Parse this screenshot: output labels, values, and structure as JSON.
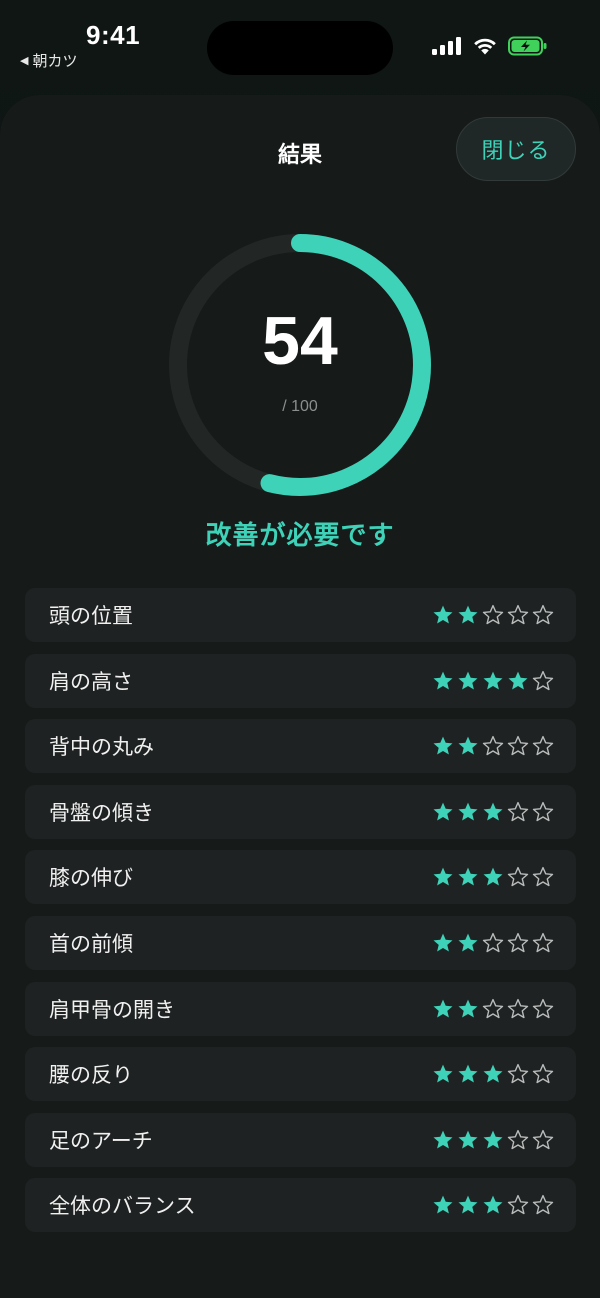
{
  "status_bar": {
    "time": "9:41",
    "back_app": "朝カツ",
    "back_icon": "back-triangle-icon"
  },
  "colors": {
    "accent": "#3ed2b8",
    "sheet": "#161a19",
    "row": "#1f2222",
    "star_empty": "#b9bcbb",
    "ring_track": "#222625",
    "battery": "#3fd15a"
  },
  "header": {
    "title": "結果",
    "close_label": "閉じる"
  },
  "score": {
    "value": "54",
    "max_label": "/ 100",
    "fraction": 0.54,
    "verdict": "改善が必要です"
  },
  "metrics": [
    {
      "label": "頭の位置",
      "stars": 2,
      "max": 5
    },
    {
      "label": "肩の高さ",
      "stars": 4,
      "max": 5
    },
    {
      "label": "背中の丸み",
      "stars": 2,
      "max": 5
    },
    {
      "label": "骨盤の傾き",
      "stars": 3,
      "max": 5
    },
    {
      "label": "膝の伸び",
      "stars": 3,
      "max": 5
    },
    {
      "label": "首の前傾",
      "stars": 2,
      "max": 5
    },
    {
      "label": "肩甲骨の開き",
      "stars": 2,
      "max": 5
    },
    {
      "label": "腰の反り",
      "stars": 3,
      "max": 5
    },
    {
      "label": "足のアーチ",
      "stars": 3,
      "max": 5
    },
    {
      "label": "全体のバランス",
      "stars": 3,
      "max": 5
    }
  ]
}
